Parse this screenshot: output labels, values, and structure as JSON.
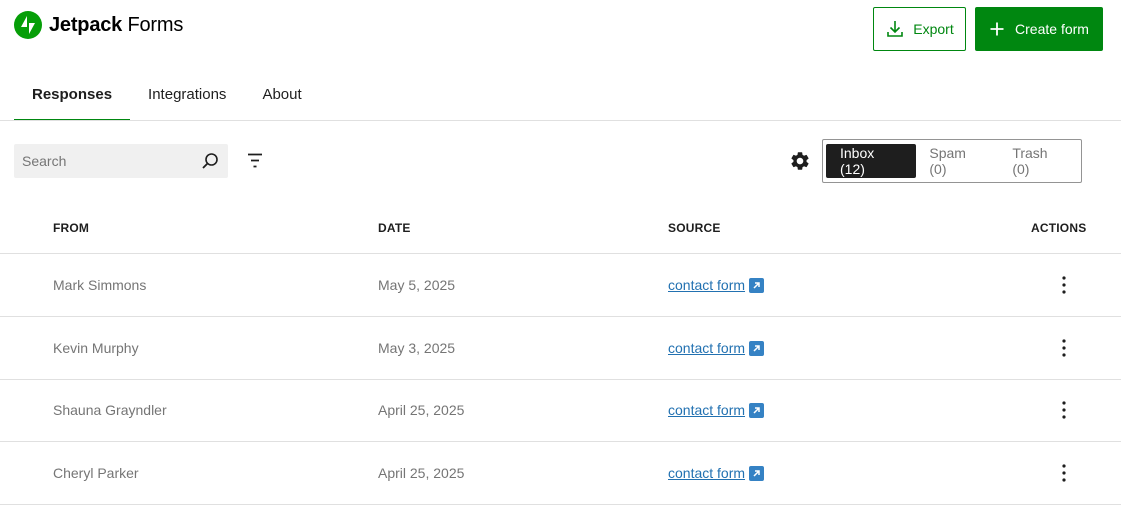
{
  "brand": {
    "name_bold": "Jetpack",
    "name_rest": "Forms"
  },
  "header": {
    "export_label": "Export",
    "create_label": "Create form"
  },
  "tabs": [
    {
      "label": "Responses",
      "active": true
    },
    {
      "label": "Integrations",
      "active": false
    },
    {
      "label": "About",
      "active": false
    }
  ],
  "toolbar": {
    "search_placeholder": "Search",
    "folders": [
      {
        "label": "Inbox (12)",
        "active": true
      },
      {
        "label": "Spam (0)",
        "active": false
      },
      {
        "label": "Trash (0)",
        "active": false
      }
    ]
  },
  "table": {
    "columns": {
      "from": "FROM",
      "date": "DATE",
      "source": "SOURCE",
      "actions": "ACTIONS"
    },
    "rows": [
      {
        "from": "Mark Simmons",
        "date": "May 5, 2025",
        "source": "contact form"
      },
      {
        "from": "Kevin Murphy",
        "date": "May 3, 2025",
        "source": "contact form"
      },
      {
        "from": "Shauna Grayndler",
        "date": "April 25, 2025",
        "source": "contact form"
      },
      {
        "from": "Cheryl Parker",
        "date": "April 25, 2025",
        "source": "contact form"
      }
    ]
  },
  "colors": {
    "brand_green": "#069e08",
    "button_green": "#008710",
    "link_blue": "#2271b1",
    "inbox_active_bg": "#1e1e1e"
  },
  "icons": [
    "jetpack-logo-icon",
    "download-icon",
    "plus-icon",
    "search-icon",
    "filter-icon",
    "gear-icon",
    "external-link-icon",
    "more-vertical-icon"
  ]
}
